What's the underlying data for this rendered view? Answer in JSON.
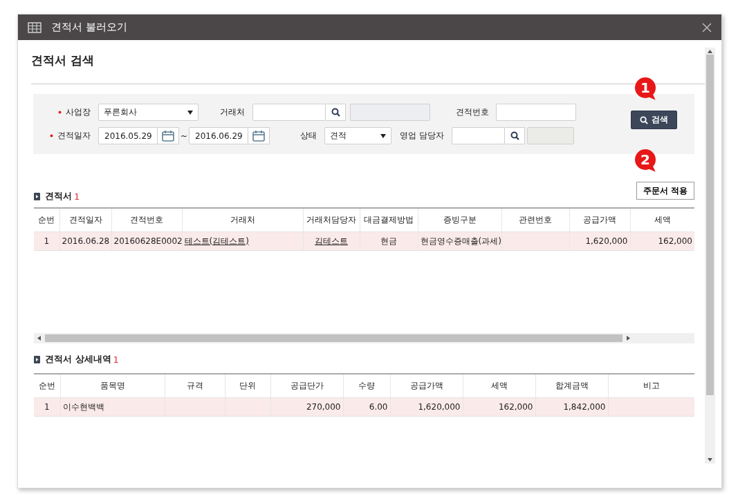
{
  "dialog": {
    "title": "견적서 불러오기"
  },
  "heading": "견적서 검색",
  "search": {
    "business": {
      "label": "사업장",
      "required": true,
      "value": "푸른회사"
    },
    "client": {
      "label": "거래처"
    },
    "quote_no": {
      "label": "견적번호"
    },
    "date": {
      "label": "견적일자",
      "required": true,
      "from": "2016.05.29",
      "separator": "~",
      "to": "2016.06.29"
    },
    "status": {
      "label": "상태",
      "value": "견적"
    },
    "sales_rep": {
      "label": "영업 담당자"
    },
    "search_button": "검색"
  },
  "callouts": [
    "1",
    "2"
  ],
  "apply_button": "주문서 적용",
  "quotes": {
    "title": "견적서",
    "count": "1",
    "columns": [
      {
        "label": "순번",
        "kind": "center"
      },
      {
        "label": "견적일자",
        "kind": "center"
      },
      {
        "label": "견적번호",
        "kind": "center"
      },
      {
        "label": "거래처",
        "kind": "link"
      },
      {
        "label": "거래처담당자",
        "kind": "center_link"
      },
      {
        "label": "대금결제방법",
        "kind": "center"
      },
      {
        "label": "증빙구분",
        "kind": "center"
      },
      {
        "label": "관련번호",
        "kind": "center"
      },
      {
        "label": "공급가액",
        "kind": "number"
      },
      {
        "label": "세액",
        "kind": "number"
      }
    ],
    "rows": [
      {
        "selected": true,
        "cells": [
          "1",
          "2016.06.28",
          "20160628E0002",
          "테스트(김테스트)",
          "김테스트",
          "현금",
          "현금영수증매출(과세)",
          null,
          "1,620,000",
          "162,000"
        ]
      }
    ]
  },
  "details": {
    "title": "견적서 상세내역",
    "count": "1",
    "columns": [
      {
        "label": "순번",
        "kind": "center"
      },
      {
        "label": "품목명",
        "kind": "text"
      },
      {
        "label": "규격",
        "kind": "center"
      },
      {
        "label": "단위",
        "kind": "center"
      },
      {
        "label": "공급단가",
        "kind": "number"
      },
      {
        "label": "수량",
        "kind": "number"
      },
      {
        "label": "공급가액",
        "kind": "number"
      },
      {
        "label": "세액",
        "kind": "number"
      },
      {
        "label": "합계금액",
        "kind": "number"
      },
      {
        "label": "비고",
        "kind": "center"
      }
    ],
    "rows": [
      {
        "selected": true,
        "cells": [
          "1",
          "이수현백백",
          null,
          null,
          "270,000",
          "6.00",
          "1,620,000",
          "162,000",
          "1,842,000",
          null
        ]
      }
    ]
  }
}
